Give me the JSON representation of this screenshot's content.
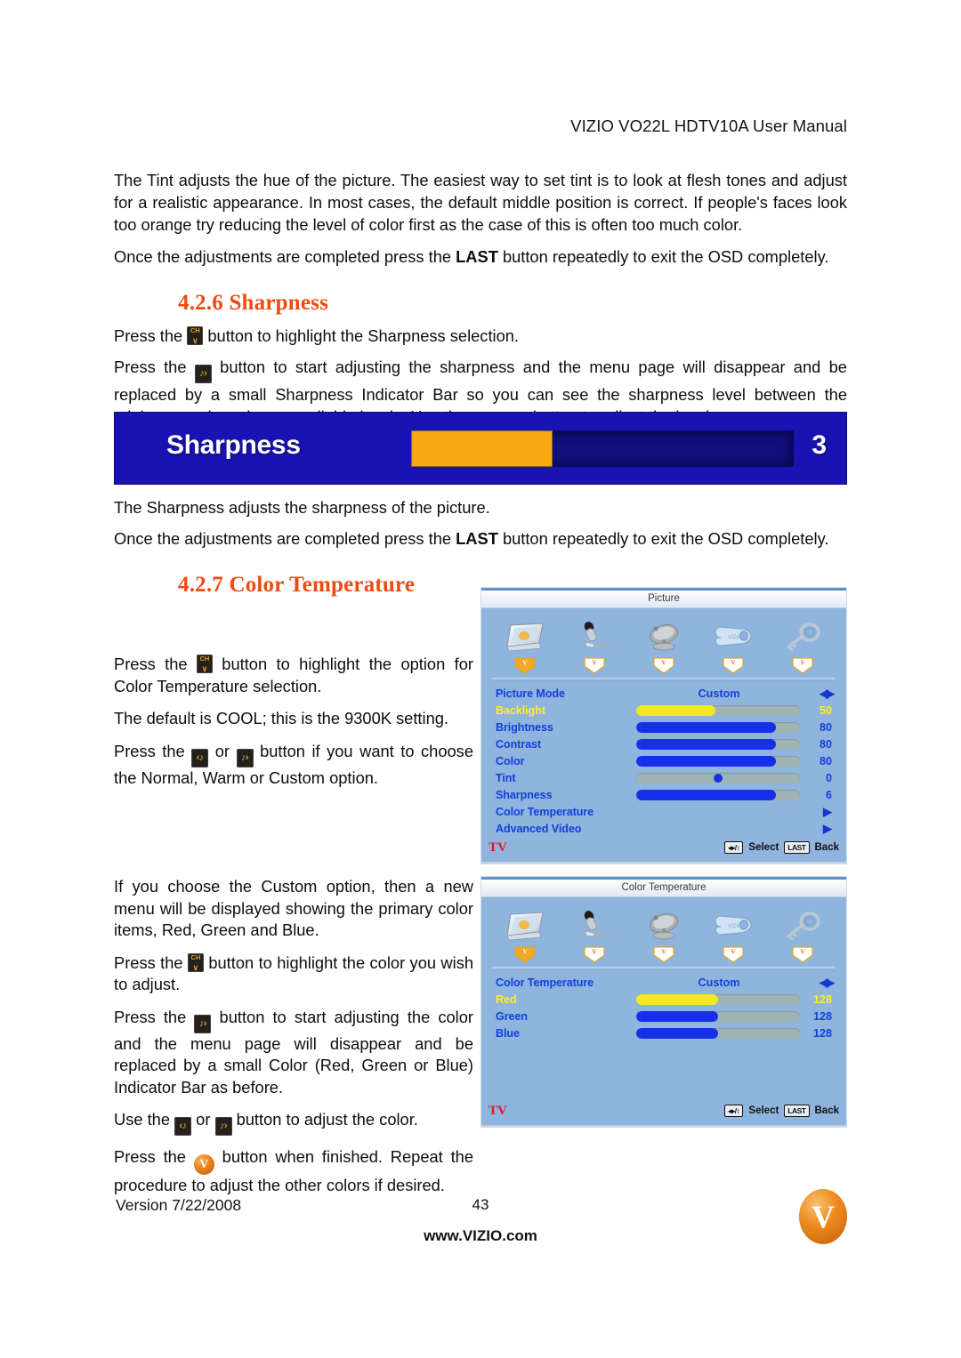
{
  "header": {
    "title": "VIZIO VO22L HDTV10A User Manual"
  },
  "intro": {
    "para1": "The Tint adjusts the hue of the picture.  The easiest way to set tint is to look at flesh tones and adjust for a realistic appearance.  In most cases, the default middle position is correct.  If people's faces look too orange try reducing the level of color first as the case of this is often too much color.",
    "para2_a": "Once the adjustments are completed press the ",
    "para2_b": "LAST",
    "para2_c": " button repeatedly to exit the OSD completely."
  },
  "sharpness_section": {
    "heading": "4.2.6 Sharpness",
    "para1_a": "Press the ",
    "para1_b": " button to highlight the Sharpness selection.",
    "para2_a": "Press the ",
    "para2_b": " button to start adjusting the sharpness and the menu page will disappear and be replaced by a small Sharpness Indicator Bar so you can see the sharpness level between the minimum and maximum available levels.  Use the ",
    "para2_c": " or ",
    "para2_d": " button to adjust the level.",
    "after1": "The Sharpness adjusts the sharpness of the picture.",
    "after2_a": "Once the adjustments are completed press the ",
    "after2_b": "LAST",
    "after2_c": " button repeatedly to exit the OSD completely."
  },
  "sharpness_bar": {
    "label": "Sharpness",
    "value": "3",
    "fill_percent": 37,
    "bg_color": "#1a13b4",
    "fill_color": "#f6a912"
  },
  "colortemp_section": {
    "heading": "4.2.7 Color Temperature",
    "para1_a": "Press the ",
    "para1_b": " button to highlight the option for Color Temperature selection.",
    "para2": "The default is COOL; this is the 9300K setting.",
    "para3_a": "Press the ",
    "para3_b": " or ",
    "para3_c": " button if you want to choose the Normal, Warm or Custom option.",
    "para4": "If you choose the Custom option, then a new menu will be displayed showing the primary color items, Red, Green and Blue.",
    "para5_a": "Press the ",
    "para5_b": " button to highlight the color you wish to adjust.",
    "para6_a": "Press the ",
    "para6_b": " button to start adjusting the color and the menu page will disappear and be replaced by a small Color (Red, Green or Blue) Indicator Bar as before.",
    "para7_a": "Use the ",
    "para7_b": " or ",
    "para7_c": " button to adjust the color.",
    "para8_a": "Press the ",
    "para8_b": " button when finished.  Repeat the procedure to adjust the other colors if desired."
  },
  "keys": {
    "ch_top": "CH",
    "ch_bottom": "∨",
    "left": "‹♪",
    "right": "♪›",
    "v": "V"
  },
  "osd_picture": {
    "title": "Picture",
    "icons": [
      {
        "name": "tv-screen-icon"
      },
      {
        "name": "microphone-icon"
      },
      {
        "name": "satellite-dish-icon"
      },
      {
        "name": "wrench-icon"
      },
      {
        "name": "key-icon"
      }
    ],
    "rows": [
      {
        "label": "Picture Mode",
        "type": "option",
        "value": "Custom",
        "arrow": "leftright",
        "selected": false
      },
      {
        "label": "Backlight",
        "type": "slider",
        "value": "50",
        "fill": 48,
        "color": "yellow",
        "selected": true
      },
      {
        "label": "Brightness",
        "type": "slider",
        "value": "80",
        "fill": 85,
        "color": "blue",
        "selected": false
      },
      {
        "label": "Contrast",
        "type": "slider",
        "value": "80",
        "fill": 85,
        "color": "blue",
        "selected": false
      },
      {
        "label": "Color",
        "type": "slider",
        "value": "80",
        "fill": 85,
        "color": "blue",
        "selected": false
      },
      {
        "label": "Tint",
        "type": "slider-dot",
        "value": "0",
        "fill": 0,
        "dot": 50,
        "color": "blue",
        "selected": false
      },
      {
        "label": "Sharpness",
        "type": "slider",
        "value": "6",
        "fill": 85,
        "color": "blue",
        "selected": false
      },
      {
        "label": "Color Temperature",
        "type": "submenu",
        "value": "",
        "arrow": "right",
        "selected": false
      },
      {
        "label": "Advanced Video",
        "type": "submenu",
        "value": "",
        "arrow": "right",
        "selected": false
      }
    ],
    "footer": {
      "source": "TV",
      "nav_pill": "◂▸/↕",
      "select": "Select",
      "last_pill": "LAST",
      "back": "Back"
    }
  },
  "osd_colortemp": {
    "title": "Color Temperature",
    "icons": [
      {
        "name": "tv-screen-icon"
      },
      {
        "name": "microphone-icon"
      },
      {
        "name": "satellite-dish-icon"
      },
      {
        "name": "wrench-icon"
      },
      {
        "name": "key-icon"
      }
    ],
    "rows": [
      {
        "label": "Color Temperature",
        "type": "option",
        "value": "Custom",
        "arrow": "leftright",
        "selected": false
      },
      {
        "label": "Red",
        "type": "slider",
        "value": "128",
        "fill": 50,
        "color": "yellow",
        "selected": true
      },
      {
        "label": "Green",
        "type": "slider",
        "value": "128",
        "fill": 50,
        "color": "blue",
        "selected": false
      },
      {
        "label": "Blue",
        "type": "slider",
        "value": "128",
        "fill": 50,
        "color": "blue",
        "selected": false
      }
    ],
    "footer": {
      "source": "TV",
      "nav_pill": "◂▸/↕",
      "select": "Select",
      "last_pill": "LAST",
      "back": "Back"
    }
  },
  "footer": {
    "version": "Version 7/22/2008",
    "page_number": "43",
    "website": "www.VIZIO.com",
    "logo_letter": "V"
  },
  "colors": {
    "heading_orange": "#f04a10",
    "osd_bg": "#8fb4dd",
    "osd_label_blue": "#1340d8",
    "osd_selected_yellow": "#ffee2a",
    "slider_blue": "#1530e8",
    "slider_yellow": "#f2e81f",
    "slider_track": "#9fb5b3",
    "tv_red": "#e01b1b"
  }
}
